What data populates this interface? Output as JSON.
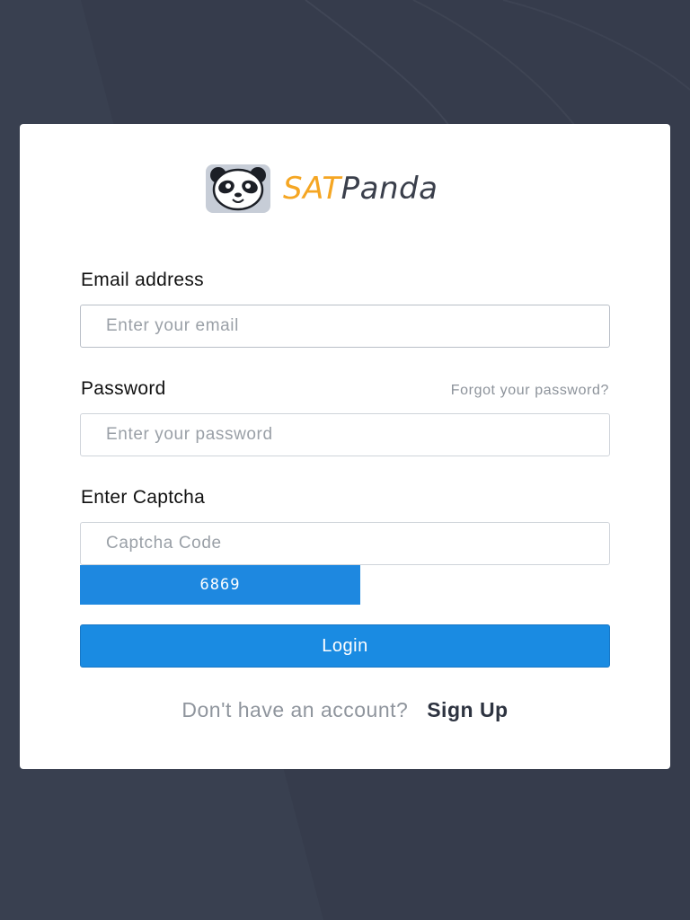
{
  "brand": {
    "logo_icon": "panda-icon",
    "name_part1": "SAT",
    "name_part2": "Panda",
    "accent_color": "#f5a623",
    "dark_color": "#3a3f4b"
  },
  "form": {
    "email": {
      "label": "Email address",
      "placeholder": "Enter your email",
      "value": ""
    },
    "password": {
      "label": "Password",
      "placeholder": "Enter your password",
      "value": "",
      "forgot_link": "Forgot your password?"
    },
    "captcha": {
      "label": "Enter Captcha",
      "placeholder": "Captcha Code",
      "value": "",
      "code": "6869"
    },
    "login_button": "Login"
  },
  "footer": {
    "question": "Don't have an account?",
    "signup_link": "Sign Up"
  },
  "colors": {
    "background": "#363c4c",
    "primary_button": "#1a8be2"
  }
}
